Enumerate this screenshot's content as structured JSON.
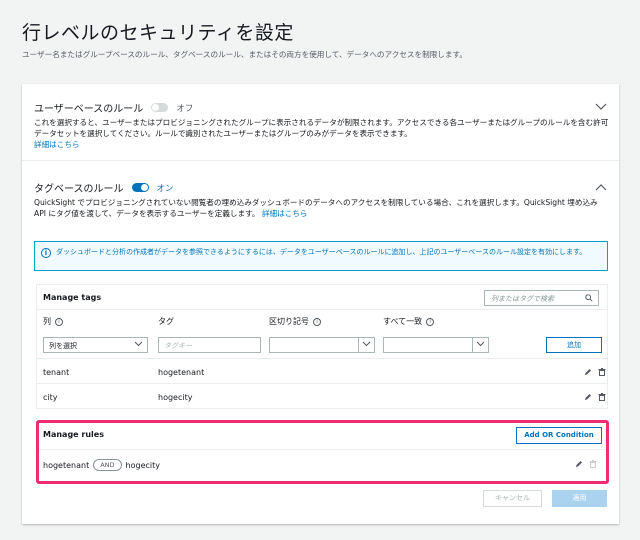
{
  "page": {
    "title": "行レベルのセキュリティを設定",
    "subtitle": "ユーザー名またはグループベースのルール、タグベースのルール、またはその両方を使用して、データへのアクセスを制限します。"
  },
  "user_rules": {
    "title": "ユーザーベースのルール",
    "toggle_label": "オフ",
    "enabled": false,
    "description": "これを選択すると、ユーザーまたはプロビジョニングされたグループに表示されるデータが制限されます。アクセスできる各ユーザーまたはグループのルールを含む許可データセットを選択してください。ルールで識別されたユーザーまたはグループのみがデータを表示できます。",
    "link": "詳細はこちら"
  },
  "tag_rules": {
    "title": "タグベースのルール",
    "toggle_label": "オン",
    "enabled": true,
    "description": "QuickSight でプロビジョニングされていない閲覧者の埋め込みダッシュボードのデータへのアクセスを制限している場合、これを選択します。QuickSight 埋め込み API にタグ値を渡して、データを表示するユーザーを定義します。",
    "link": "詳細はこちら",
    "info": "ダッシュボードと分析の作成者がデータを参照できるようにするには、データをユーザーベースのルールに追加し、上記のユーザーベースのルール設定を有効にします。"
  },
  "manage_tags": {
    "title": "Manage tags",
    "search_placeholder": "列またはタグで検索",
    "columns": {
      "column": "列",
      "tag": "タグ",
      "delimiter": "区切り記号",
      "match_all": "すべて一致"
    },
    "column_select": "列を選択",
    "tag_placeholder": "タグキー",
    "add_label": "追加",
    "rows": [
      {
        "column": "tenant",
        "tag": "hogetenant"
      },
      {
        "column": "city",
        "tag": "hogecity"
      }
    ]
  },
  "manage_rules": {
    "title": "Manage rules",
    "add_or_label": "Add OR Condition",
    "rule": {
      "left": "hogetenant",
      "op": "AND",
      "right": "hogecity"
    }
  },
  "footer": {
    "cancel": "キャンセル",
    "apply": "適用"
  },
  "colors": {
    "accent": "#0073bb",
    "highlight": "#ee2d74"
  }
}
